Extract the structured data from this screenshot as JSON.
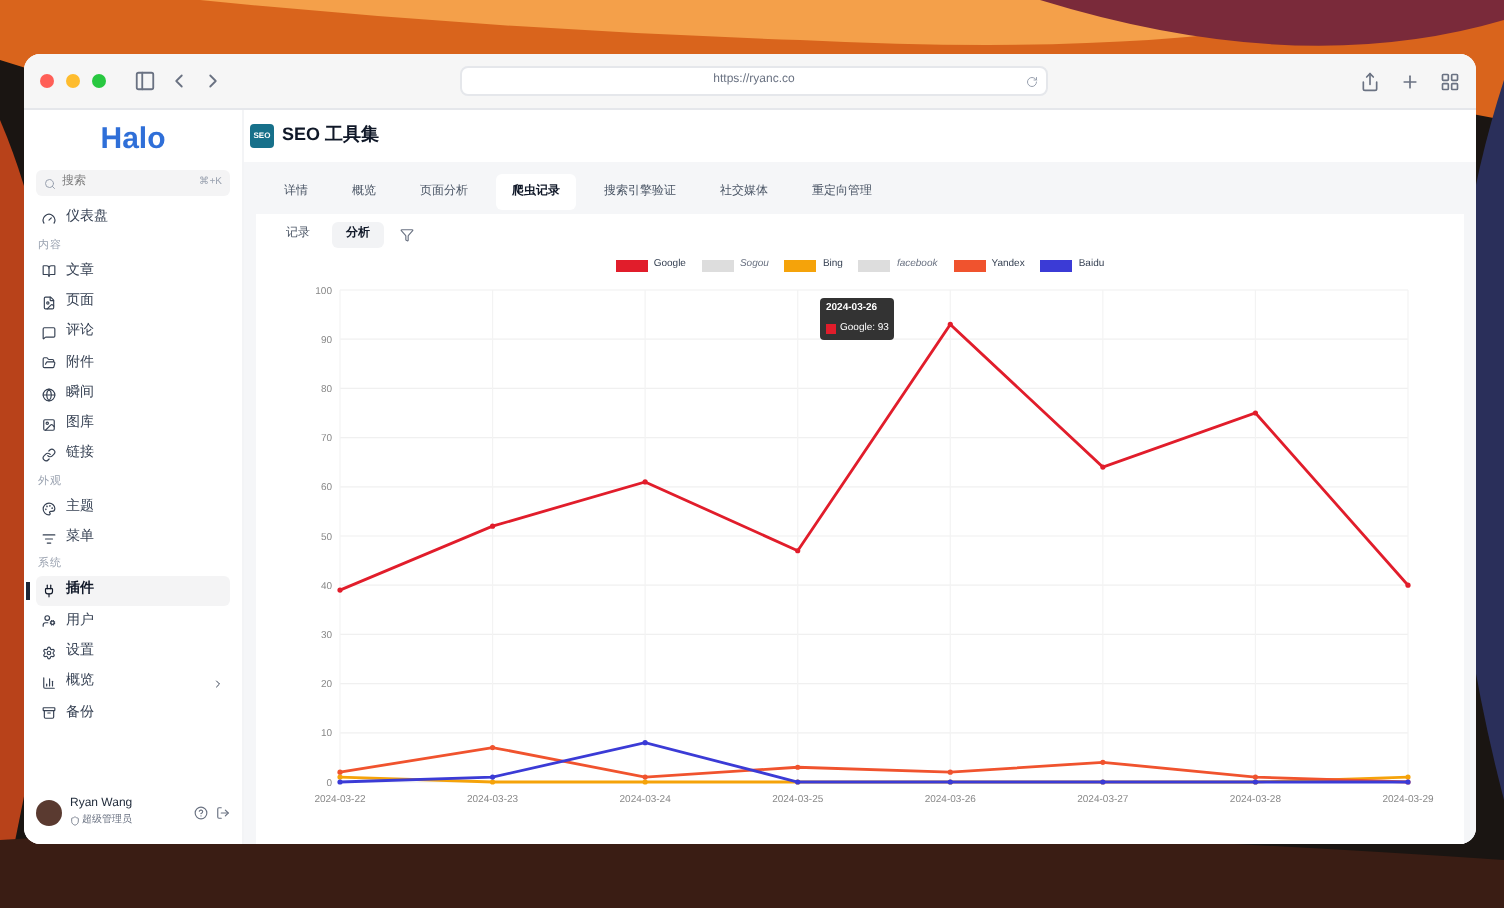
{
  "browser": {
    "url": "https://ryanc.co"
  },
  "sidebar": {
    "logo": "Halo",
    "search": {
      "placeholder": "搜索",
      "shortcut": "⌘+K"
    },
    "groups": [
      {
        "items": [
          {
            "label": "仪表盘",
            "selected": false,
            "has_submenu": false
          }
        ]
      },
      {
        "label": "内容",
        "items": [
          {
            "label": "文章",
            "selected": false,
            "has_submenu": false
          },
          {
            "label": "页面",
            "selected": false,
            "has_submenu": false
          },
          {
            "label": "评论",
            "selected": false,
            "has_submenu": false
          },
          {
            "label": "附件",
            "selected": false,
            "has_submenu": false
          },
          {
            "label": "瞬间",
            "selected": false,
            "has_submenu": false
          },
          {
            "label": "图库",
            "selected": false,
            "has_submenu": false
          },
          {
            "label": "链接",
            "selected": false,
            "has_submenu": false
          }
        ]
      },
      {
        "label": "外观",
        "items": [
          {
            "label": "主题",
            "selected": false,
            "has_submenu": false
          },
          {
            "label": "菜单",
            "selected": false,
            "has_submenu": false
          }
        ]
      },
      {
        "label": "系统",
        "items": [
          {
            "label": "插件",
            "selected": true,
            "has_submenu": false
          },
          {
            "label": "用户",
            "selected": false,
            "has_submenu": false
          },
          {
            "label": "设置",
            "selected": false,
            "has_submenu": false
          },
          {
            "label": "概览",
            "selected": false,
            "has_submenu": true
          },
          {
            "label": "备份",
            "selected": false,
            "has_submenu": false
          }
        ]
      }
    ],
    "user": {
      "name": "Ryan Wang",
      "role": "超级管理员"
    }
  },
  "header": {
    "badge": "SEO",
    "title": "SEO 工具集"
  },
  "tabs": [
    {
      "label": "详情",
      "selected": false
    },
    {
      "label": "概览",
      "selected": false
    },
    {
      "label": "页面分析",
      "selected": false
    },
    {
      "label": "爬虫记录",
      "selected": true
    },
    {
      "label": "搜索引擎验证",
      "selected": false
    },
    {
      "label": "社交媒体",
      "selected": false
    },
    {
      "label": "重定向管理",
      "selected": false
    }
  ],
  "subtabs": [
    {
      "label": "记录",
      "selected": false
    },
    {
      "label": "分析",
      "selected": true
    }
  ],
  "chart": {
    "tooltip": {
      "title": "2024-03-26",
      "label": "Google: 93",
      "color": "#e11d2b"
    },
    "chart_data": {
      "type": "line",
      "categories": [
        "2024-03-22",
        "2024-03-23",
        "2024-03-24",
        "2024-03-25",
        "2024-03-26",
        "2024-03-27",
        "2024-03-28",
        "2024-03-29"
      ],
      "ylim": [
        0,
        100
      ],
      "yticks": [
        0,
        10,
        20,
        30,
        40,
        50,
        60,
        70,
        80,
        90,
        100
      ],
      "grid": true,
      "series": [
        {
          "name": "Google",
          "color": "#e11d2b",
          "values": [
            39,
            52,
            61,
            47,
            93,
            64,
            75,
            40
          ]
        },
        {
          "name": "Sogou",
          "color": "#dddddd",
          "values": [
            null,
            null,
            null,
            null,
            null,
            null,
            null,
            null
          ]
        },
        {
          "name": "Bing",
          "color": "#f5a30a",
          "values": [
            1,
            0,
            0,
            0,
            0,
            0,
            0,
            1
          ]
        },
        {
          "name": "facebook",
          "color": "#dddddd",
          "values": [
            null,
            null,
            null,
            null,
            null,
            null,
            null,
            null
          ]
        },
        {
          "name": "Yandex",
          "color": "#f0532e",
          "values": [
            2,
            7,
            1,
            3,
            2,
            4,
            1,
            0
          ]
        },
        {
          "name": "Baidu",
          "color": "#3b3bd6",
          "values": [
            0,
            1,
            8,
            0,
            0,
            0,
            0,
            0
          ]
        }
      ]
    }
  }
}
